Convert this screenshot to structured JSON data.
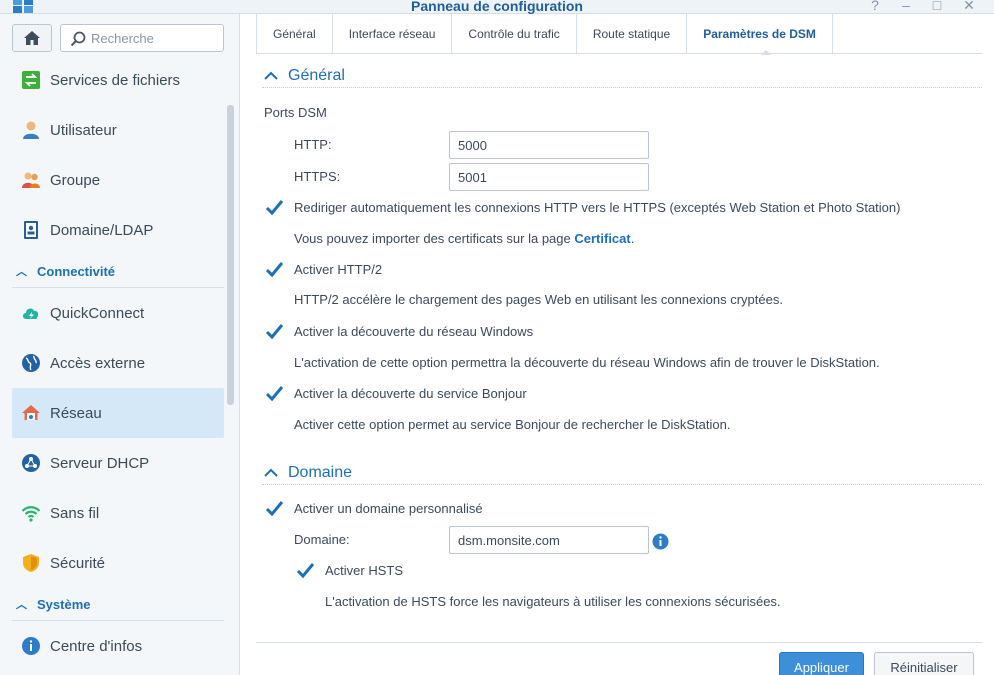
{
  "window": {
    "title": "Panneau de configuration",
    "help": "?",
    "minimize": "–",
    "maximize": "□",
    "close": "✕"
  },
  "sidebar": {
    "search_placeholder": "Recherche",
    "items": [
      {
        "label": "Services de fichiers",
        "icon": "file-services-icon"
      },
      {
        "label": "Utilisateur",
        "icon": "user-icon"
      },
      {
        "label": "Groupe",
        "icon": "group-icon"
      },
      {
        "label": "Domaine/LDAP",
        "icon": "domain-ldap-icon"
      },
      {
        "label": "QuickConnect",
        "icon": "quickconnect-icon"
      },
      {
        "label": "Accès externe",
        "icon": "external-access-icon"
      },
      {
        "label": "Réseau",
        "icon": "network-icon",
        "selected": true
      },
      {
        "label": "Serveur DHCP",
        "icon": "dhcp-server-icon"
      },
      {
        "label": "Sans fil",
        "icon": "wireless-icon"
      },
      {
        "label": "Sécurité",
        "icon": "security-icon"
      },
      {
        "label": "Centre d'infos",
        "icon": "info-center-icon"
      }
    ],
    "sections": {
      "connectivity": "Connectivité",
      "system": "Système"
    }
  },
  "tabs": [
    {
      "label": "Général"
    },
    {
      "label": "Interface réseau"
    },
    {
      "label": "Contrôle du trafic"
    },
    {
      "label": "Route statique"
    },
    {
      "label": "Paramètres de DSM",
      "active": true
    }
  ],
  "general": {
    "header": "Général",
    "ports_label": "Ports DSM",
    "http_label": "HTTP:",
    "http_value": "5000",
    "https_label": "HTTPS:",
    "https_value": "5001",
    "redirect_label": "Rediriger automatiquement les connexions HTTP vers le HTTPS (exceptés Web Station et Photo Station)",
    "redirect_checked": true,
    "cert_note_prefix": "Vous pouvez importer des certificats sur la page ",
    "cert_link": "Certificat",
    "cert_note_suffix": ".",
    "http2_label": "Activer HTTP/2",
    "http2_checked": true,
    "http2_note": "HTTP/2 accélère le chargement des pages Web en utilisant les connexions cryptées.",
    "windows_label": "Activer la découverte du réseau Windows",
    "windows_checked": true,
    "windows_note": "L'activation de cette option permettra la découverte du réseau Windows afin de trouver le DiskStation.",
    "bonjour_label": "Activer la découverte du service Bonjour",
    "bonjour_checked": true,
    "bonjour_note": "Activer cette option permet au service Bonjour de rechercher le DiskStation."
  },
  "domain": {
    "header": "Domaine",
    "custom_label": "Activer un domaine personnalisé",
    "custom_checked": true,
    "domain_label": "Domaine:",
    "domain_value": "dsm.monsite.com",
    "hsts_label": "Activer HSTS",
    "hsts_checked": true,
    "hsts_note": "L'activation de HSTS force les navigateurs à utiliser les connexions sécurisées."
  },
  "footer": {
    "apply_label": "Appliquer",
    "reset_label": "Réinitialiser"
  },
  "colors": {
    "accent": "#1e6fb5",
    "selected_bg": "#d5e8f7",
    "primary_button": "#3c8fd8"
  }
}
